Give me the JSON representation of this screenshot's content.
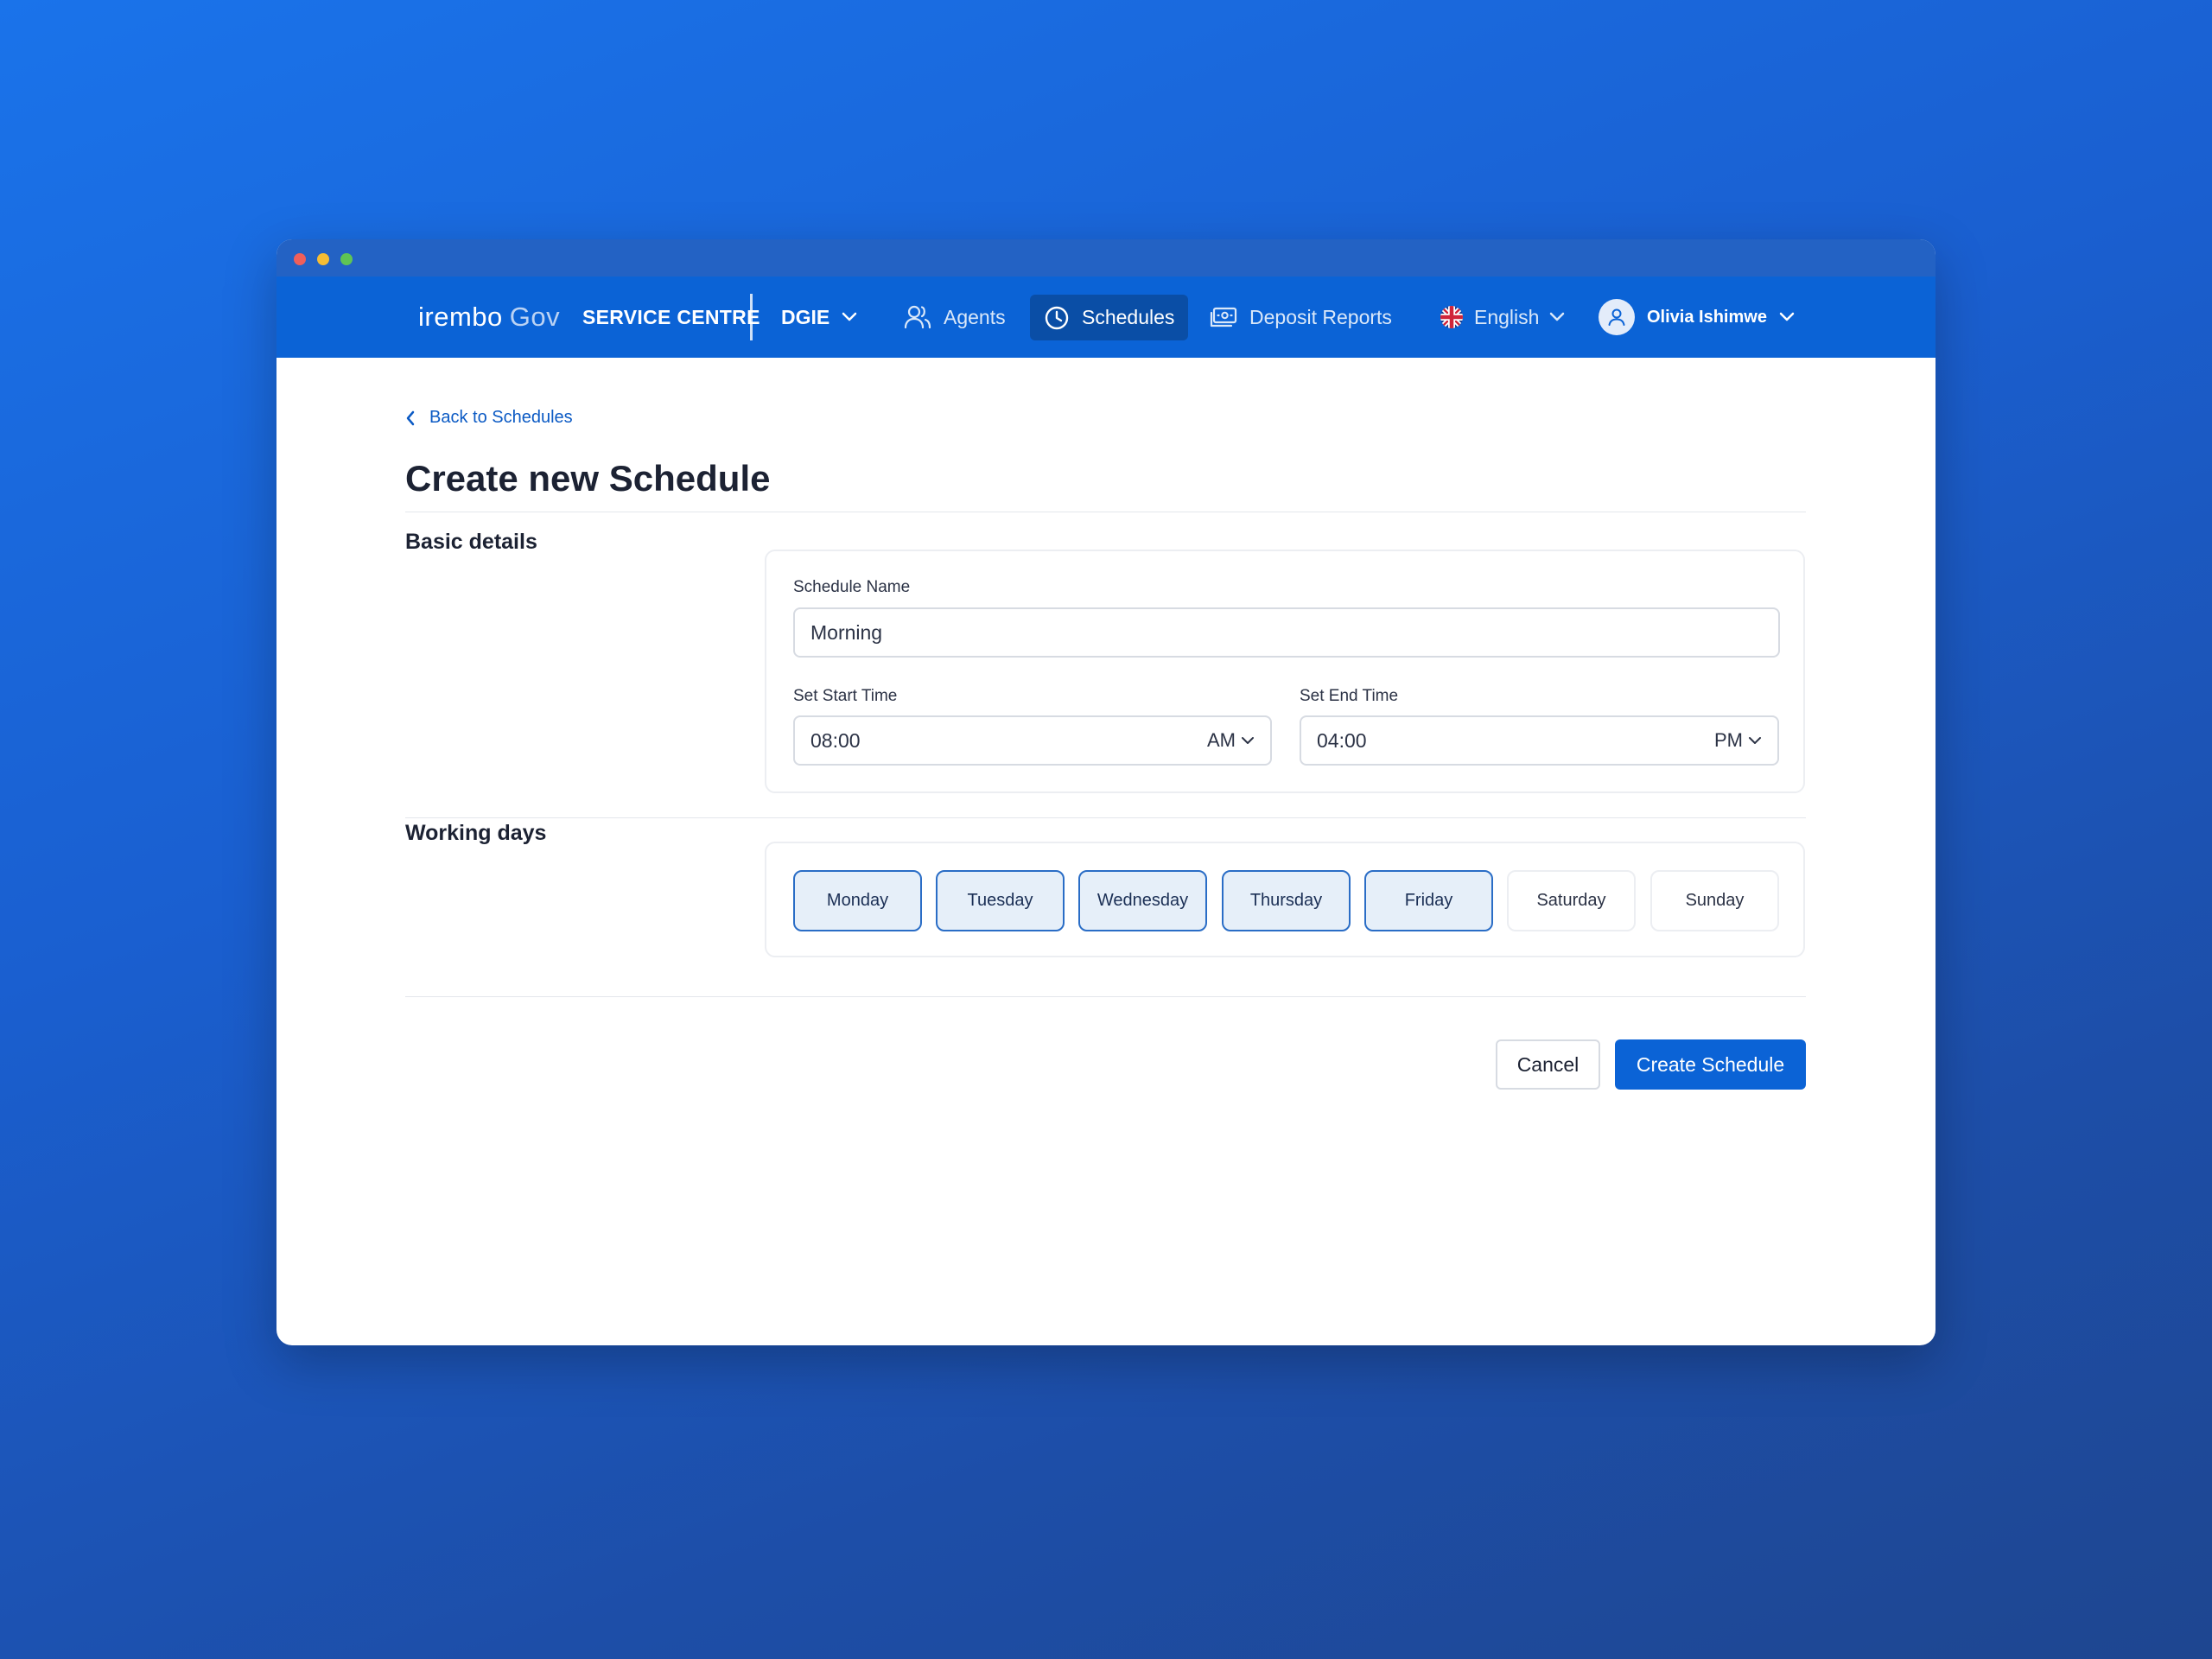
{
  "brand": {
    "name": "irembo",
    "suffix": "Gov"
  },
  "nav": {
    "service_centre": "SERVICE CENTRE",
    "org": "DGIE",
    "items": [
      {
        "label": "Agents",
        "icon": "users-icon",
        "active": false
      },
      {
        "label": "Schedules",
        "icon": "clock-icon",
        "active": true
      },
      {
        "label": "Deposit Reports",
        "icon": "banknote-icon",
        "active": false
      }
    ],
    "language": "English",
    "user_name": "Olivia Ishimwe"
  },
  "page": {
    "back_link": "Back to Schedules",
    "title": "Create new Schedule"
  },
  "basic_details": {
    "section_label": "Basic details",
    "schedule_name_label": "Schedule Name",
    "schedule_name_value": "Morning",
    "start_time_label": "Set Start Time",
    "start_time_value": "08:00",
    "start_time_period": "AM",
    "end_time_label": "Set End Time",
    "end_time_value": "04:00",
    "end_time_period": "PM"
  },
  "working_days": {
    "section_label": "Working days",
    "days": [
      {
        "label": "Monday",
        "selected": true
      },
      {
        "label": "Tuesday",
        "selected": true
      },
      {
        "label": "Wednesday",
        "selected": true
      },
      {
        "label": "Thursday",
        "selected": true
      },
      {
        "label": "Friday",
        "selected": true
      },
      {
        "label": "Saturday",
        "selected": false
      },
      {
        "label": "Sunday",
        "selected": false
      }
    ]
  },
  "actions": {
    "cancel_label": "Cancel",
    "create_label": "Create Schedule"
  },
  "colors": {
    "primary": "#0b63d6",
    "nav_active": "#0a4ea6",
    "day_selected_bg": "#e6eff9",
    "day_selected_border": "#2a6dc6"
  }
}
